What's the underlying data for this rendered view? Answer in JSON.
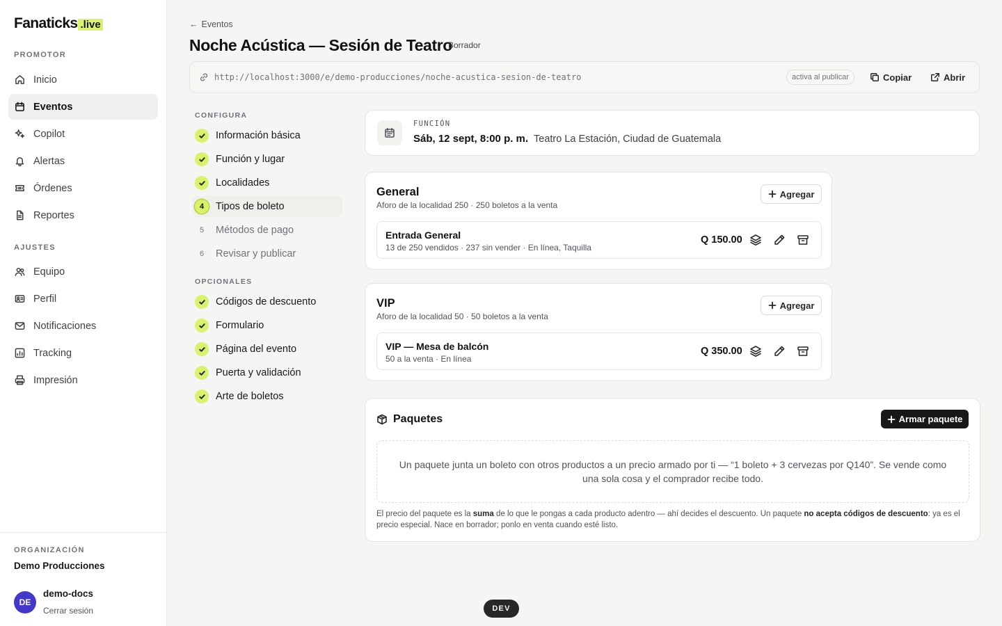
{
  "brand": {
    "name": "Fanaticks",
    "suffix": ".live"
  },
  "sidebar": {
    "section_promotor": "PROMOTOR",
    "section_ajustes": "AJUSTES",
    "promotor_items": [
      {
        "label": "Inicio",
        "icon": "home-icon"
      },
      {
        "label": "Eventos",
        "icon": "calendar-icon",
        "active": true
      },
      {
        "label": "Copilot",
        "icon": "sparkles-icon"
      },
      {
        "label": "Alertas",
        "icon": "bell-icon"
      },
      {
        "label": "Órdenes",
        "icon": "ticket-icon"
      },
      {
        "label": "Reportes",
        "icon": "file-icon"
      }
    ],
    "ajustes_items": [
      {
        "label": "Equipo",
        "icon": "users-icon"
      },
      {
        "label": "Perfil",
        "icon": "id-card-icon"
      },
      {
        "label": "Notificaciones",
        "icon": "mail-icon"
      },
      {
        "label": "Tracking",
        "icon": "chart-icon"
      },
      {
        "label": "Impresión",
        "icon": "printer-icon"
      }
    ],
    "org_label": "ORGANIZACIÓN",
    "org_name": "Demo Producciones",
    "user_initials": "DE",
    "user_name": "demo-docs",
    "logout": "Cerrar sesión"
  },
  "header": {
    "back": "Eventos",
    "title": "Noche Acústica — Sesión de Teatro",
    "status": "Borrador",
    "url": "http://localhost:3000/e/demo-producciones/noche-acustica-sesion-de-teatro",
    "url_pill": "activa al publicar",
    "copy": "Copiar",
    "open": "Abrir"
  },
  "steps": {
    "configura_label": "CONFIGURA",
    "opcionales_label": "OPCIONALES",
    "configura": [
      {
        "label": "Información básica",
        "state": "done"
      },
      {
        "label": "Función y lugar",
        "state": "done"
      },
      {
        "label": "Localidades",
        "state": "done"
      },
      {
        "label": "Tipos de boleto",
        "state": "current",
        "num": "4"
      },
      {
        "label": "Métodos de pago",
        "state": "pending",
        "num": "5"
      },
      {
        "label": "Revisar y publicar",
        "state": "pending",
        "num": "6"
      }
    ],
    "opcionales": [
      {
        "label": "Códigos de descuento",
        "state": "done"
      },
      {
        "label": "Formulario",
        "state": "done"
      },
      {
        "label": "Página del evento",
        "state": "done"
      },
      {
        "label": "Puerta y validación",
        "state": "done"
      },
      {
        "label": "Arte de boletos",
        "state": "done"
      }
    ]
  },
  "function": {
    "label": "FUNCIÓN",
    "date": "Sáb, 12 sept, 8:00 p. m.",
    "separator": "·",
    "venue": "Teatro La Estación, Ciudad de Guatemala"
  },
  "localities": [
    {
      "name": "General",
      "sub": "Aforo de la localidad 250 · 250 boletos a la venta",
      "add": "Agregar",
      "ticket": {
        "name": "Entrada General",
        "sub": "13 de 250 vendidos · 237 sin vender · En línea, Taquilla",
        "price": "Q 150.00"
      }
    },
    {
      "name": "VIP",
      "sub": "Aforo de la localidad 50 · 50 boletos a la venta",
      "add": "Agregar",
      "ticket": {
        "name": "VIP — Mesa de balcón",
        "sub": "50 a la venta · En línea",
        "price": "Q 350.00"
      }
    }
  ],
  "packages": {
    "title": "Paquetes",
    "button": "Armar paquete",
    "empty": "Un paquete junta un boleto con otros productos a un precio armado por ti — “1 boleto + 3 cervezas por Q140”. Se vende como una sola cosa y el comprador recibe todo.",
    "note_1": "El precio del paquete es la ",
    "note_b1": "suma",
    "note_2": " de lo que le pongas a cada producto adentro — ahí decides el descuento. Un paquete ",
    "note_b2": "no acepta códigos de descuento",
    "note_3": ": ya es el precio especial. Nace en borrador; ponlo en venta cuando esté listo."
  },
  "dev_badge": "DEV",
  "colors": {
    "accent": "#d9f26b",
    "avatar": "#4338ca",
    "dark": "#18181b"
  }
}
